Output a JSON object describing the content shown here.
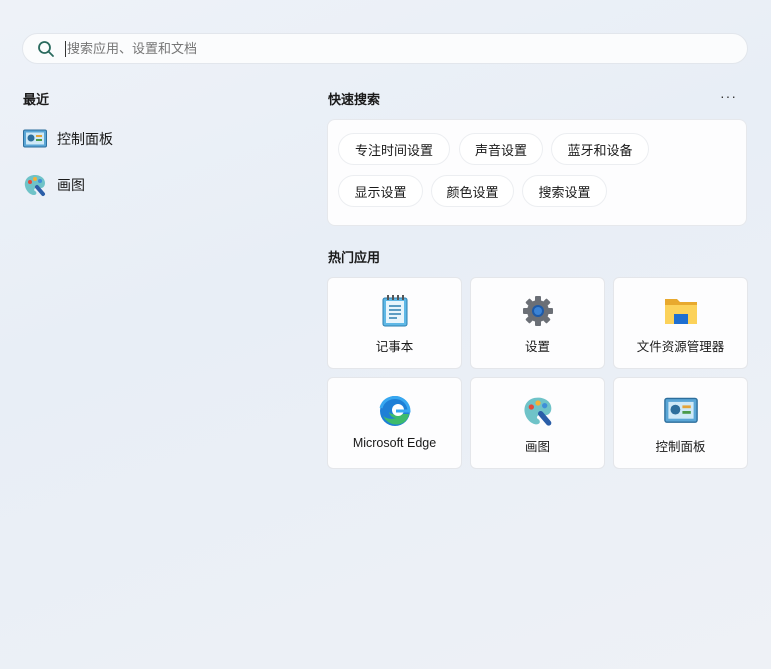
{
  "search": {
    "placeholder": "搜索应用、设置和文档"
  },
  "recent": {
    "title": "最近",
    "items": [
      {
        "label": "控制面板",
        "icon": "control-panel-icon"
      },
      {
        "label": "画图",
        "icon": "paint-icon"
      }
    ]
  },
  "quick_search": {
    "title": "快速搜索",
    "more": "···",
    "chips": [
      "专注时间设置",
      "声音设置",
      "蓝牙和设备",
      "显示设置",
      "颜色设置",
      "搜索设置"
    ]
  },
  "top_apps": {
    "title": "热门应用",
    "apps": [
      {
        "label": "记事本",
        "icon": "notepad-icon"
      },
      {
        "label": "设置",
        "icon": "settings-gear-icon"
      },
      {
        "label": "文件资源管理器",
        "icon": "file-explorer-icon"
      },
      {
        "label": "Microsoft Edge",
        "icon": "edge-icon"
      },
      {
        "label": "画图",
        "icon": "paint-icon"
      },
      {
        "label": "控制面板",
        "icon": "control-panel-icon"
      }
    ]
  }
}
